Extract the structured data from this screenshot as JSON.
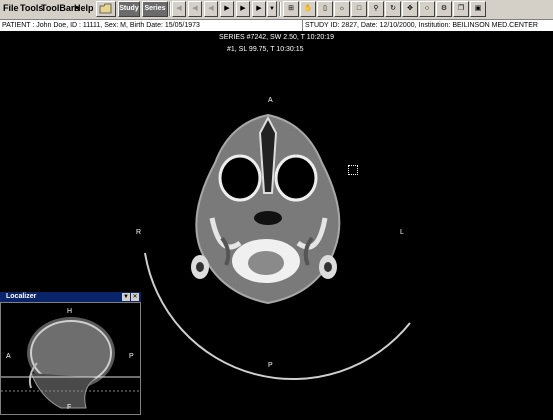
{
  "menu": {
    "file": "File",
    "tools": "Tools",
    "toolbars": "ToolBars",
    "help": "Help"
  },
  "toolbar": {
    "study_label": "Study",
    "series_label": "Series"
  },
  "patient_info": "PATIENT : John Doe, ID : 11111, Sex: M, Birth Date: 15/05/1973",
  "study_info": "STUDY ID: 2827, Date: 12/10/2000, Institution: BEILINSON MED.CENTER",
  "series_info": "SERIES #7242, SW 2.50, T 10:20:19",
  "slice_info": "#1, SL 99.75, T 10:30:15",
  "orientation": {
    "anterior": "A",
    "posterior": "P",
    "right": "R",
    "left": "L"
  },
  "localizer": {
    "title": "Localizer",
    "head": "H",
    "feet": "F",
    "anterior": "A",
    "posterior": "P"
  }
}
